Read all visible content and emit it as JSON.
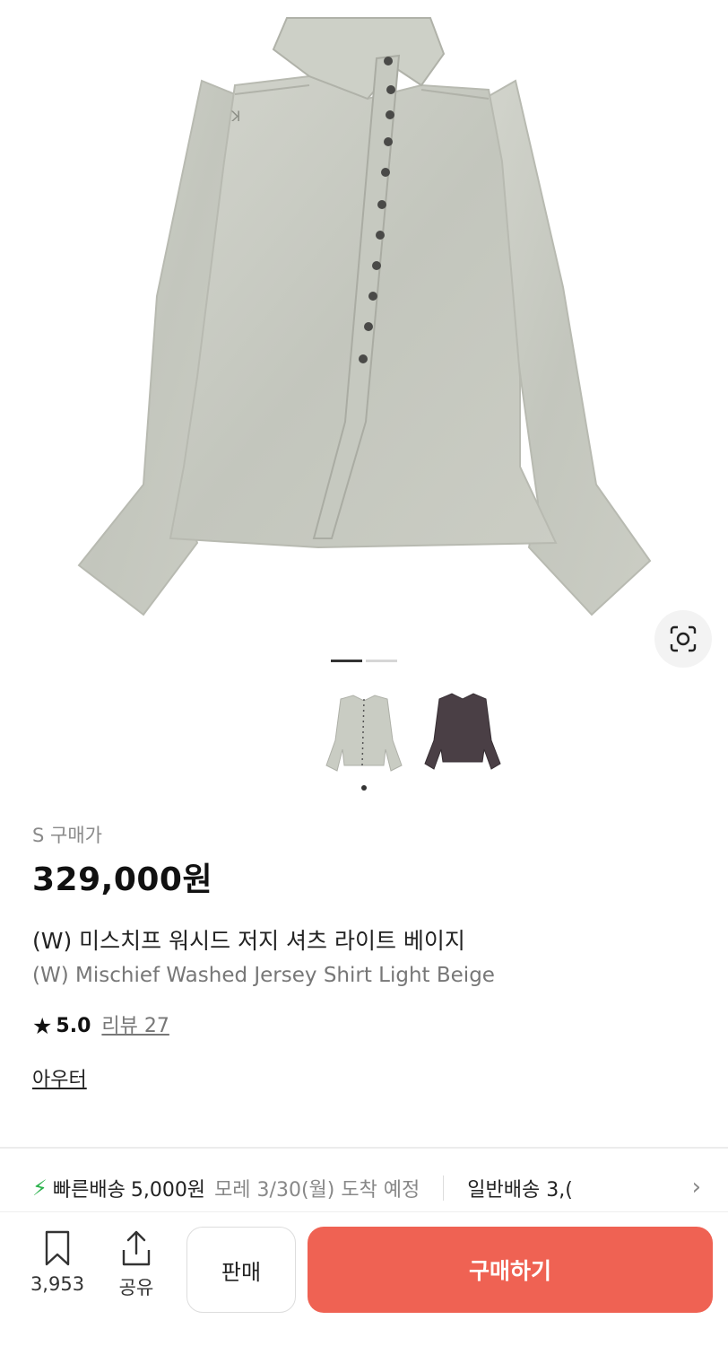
{
  "product": {
    "size_label": "S 구매가",
    "price": "329,000원",
    "title_ko": "(W) 미스치프 워시드 저지 셔츠 라이트 베이지",
    "title_en": "(W) Mischief Washed Jersey Shirt Light Beige",
    "rating": "5.0",
    "review_label": "리뷰 27",
    "category": "아우터",
    "image_count": 2,
    "active_image": 1
  },
  "delivery": {
    "fast_label": "빠른배송",
    "fast_fee": "5,000원",
    "fast_eta": "모레 3/30(월) 도착 예정",
    "normal": "일반배송 3,("
  },
  "bottom_bar": {
    "save_count": "3,953",
    "share_label": "공유",
    "sell_label": "판매",
    "buy_label": "구매하기"
  },
  "colors": {
    "buy_button": "#ef6253",
    "bolt": "#2bb24c",
    "shirt_main": "#c9ccc3",
    "shirt_alt": "#4a3f45"
  },
  "icons": [
    "lens-search-icon",
    "bookmark-icon",
    "share-icon",
    "star-icon",
    "lightning-icon",
    "chevron-right-icon"
  ]
}
